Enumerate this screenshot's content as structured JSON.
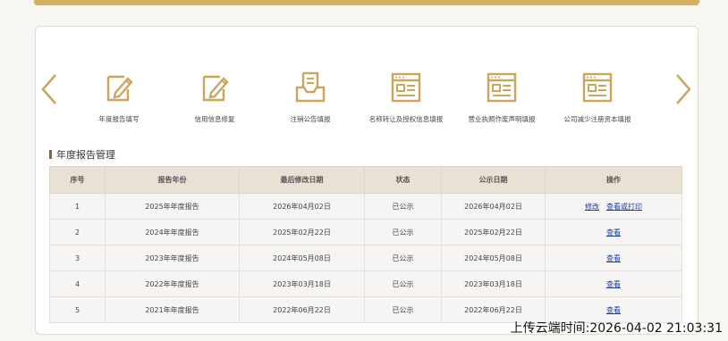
{
  "services": [
    {
      "label": "年度报告填写",
      "icon": "pencil-doc-icon"
    },
    {
      "label": "信用信息修复",
      "icon": "pencil-doc-icon"
    },
    {
      "label": "注销公告填报",
      "icon": "inbox-doc-icon"
    },
    {
      "label": "名称转让及授权信息填报",
      "icon": "form-window-icon"
    },
    {
      "label": "营业执照作废声明填报",
      "icon": "form-window-icon"
    },
    {
      "label": "公司减少注册资本填报",
      "icon": "form-window-icon"
    }
  ],
  "section": {
    "title": "年度报告管理"
  },
  "table": {
    "headers": [
      "序号",
      "报告年份",
      "最后修改日期",
      "状态",
      "公示日期",
      "操作"
    ],
    "rows": [
      {
        "no": "1",
        "year": "2025年年度报告",
        "modified": "2026年04月02日",
        "status": "已公示",
        "published": "2026年04月02日",
        "actions": [
          "修改",
          "查看或打印"
        ]
      },
      {
        "no": "2",
        "year": "2024年年度报告",
        "modified": "2025年02月22日",
        "status": "已公示",
        "published": "2025年02月22日",
        "actions": [
          "查看"
        ]
      },
      {
        "no": "3",
        "year": "2023年年度报告",
        "modified": "2024年05月08日",
        "status": "已公示",
        "published": "2024年05月08日",
        "actions": [
          "查看"
        ]
      },
      {
        "no": "4",
        "year": "2022年年度报告",
        "modified": "2023年03月18日",
        "status": "已公示",
        "published": "2023年03月18日",
        "actions": [
          "查看"
        ]
      },
      {
        "no": "5",
        "year": "2021年年度报告",
        "modified": "2022年06月22日",
        "status": "已公示",
        "published": "2022年06月22日",
        "actions": [
          "查看"
        ]
      }
    ]
  },
  "footer": {
    "timestamp": "上传云端时间:2026-04-02 21:03:31"
  },
  "colors": {
    "accent": "#d4ae61",
    "icon": "#c9a55e",
    "link": "#1a3e9a"
  }
}
